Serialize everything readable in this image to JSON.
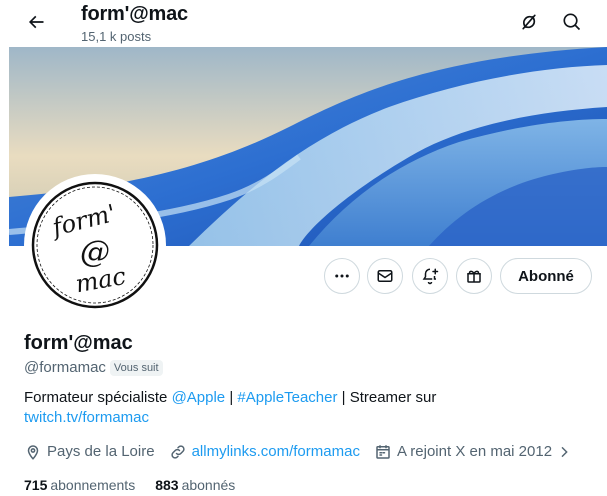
{
  "header": {
    "title": "form'@mac",
    "subtitle": "15,1 k posts"
  },
  "profile": {
    "avatar_text_lines": [
      "form'",
      "@",
      "mac"
    ],
    "name": "form'@mac",
    "handle": "@formamac",
    "follows_you_badge": "Vous suit",
    "follow_button_label": "Abonné",
    "bio": {
      "text1": "Formateur spécialiste ",
      "mention": "@Apple",
      "text2": " | ",
      "apple_glyph": "",
      "text3": " ",
      "hashtag": "#AppleTeacher",
      "text4": " | Streamer sur",
      "link": "twitch.tv/formamac"
    },
    "location": "Pays de la Loire",
    "website": "allmylinks.com/formamac",
    "joined": "A rejoint X en mai 2012",
    "following_count": "715",
    "following_label": "abonnements",
    "followers_count": "883",
    "followers_label": "abonnés"
  },
  "icons": {
    "back": "arrow-left-icon",
    "grok": "grok-icon",
    "search": "search-icon",
    "more": "more-horizontal-icon",
    "message": "envelope-icon",
    "notifications": "bell-plus-icon",
    "subscribe": "gift-icon",
    "location": "location-pin-icon",
    "link": "link-icon",
    "calendar": "calendar-icon",
    "chevron": "chevron-right-icon"
  },
  "colors": {
    "accent": "#1d9bf0",
    "text": "#0f1419",
    "muted": "#536471",
    "border": "#cfd9de"
  }
}
